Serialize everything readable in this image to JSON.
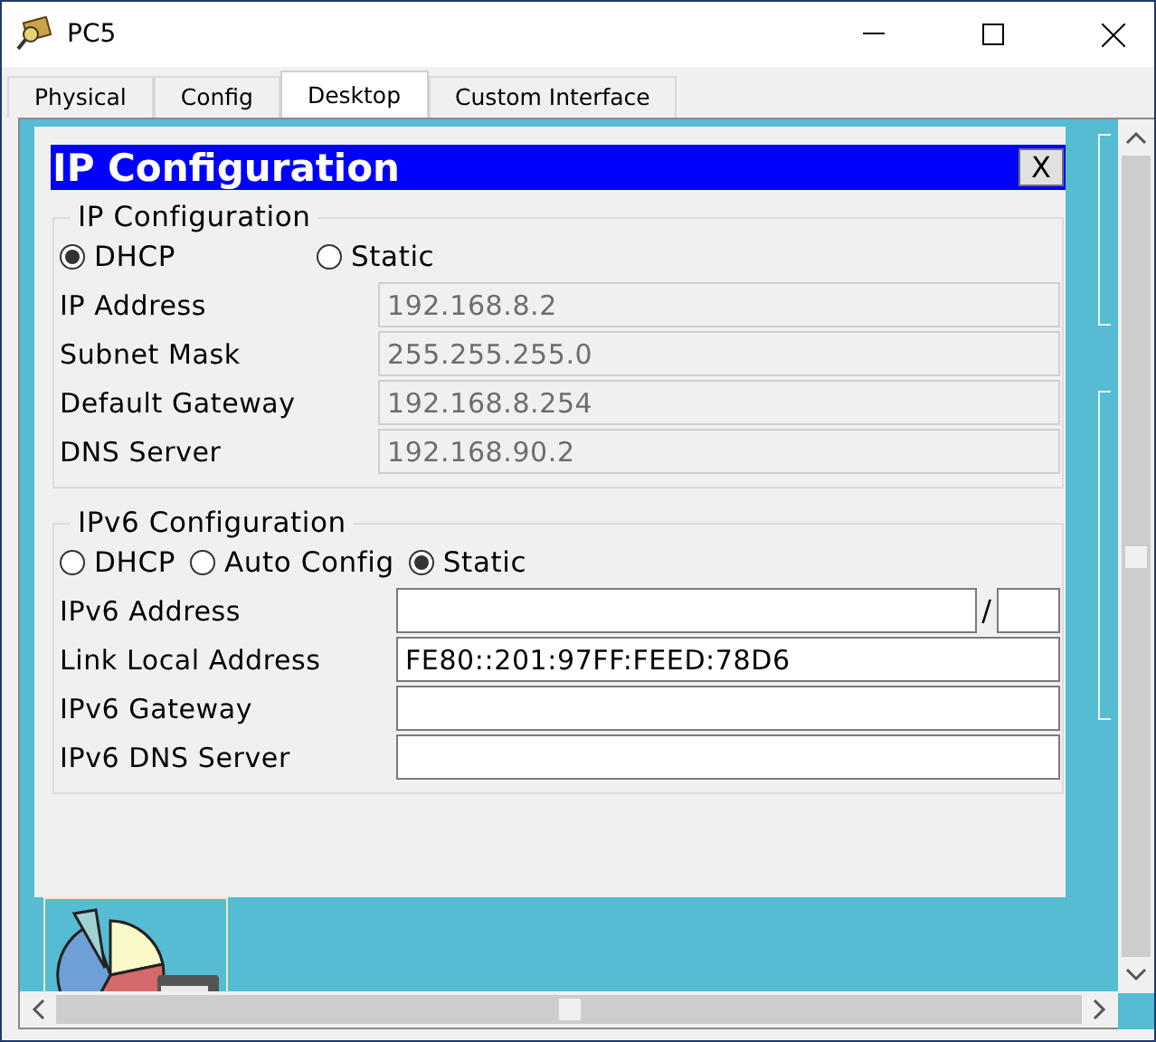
{
  "window": {
    "title": "PC5"
  },
  "tabs": [
    {
      "label": "Physical",
      "selected": false
    },
    {
      "label": "Config",
      "selected": false
    },
    {
      "label": "Desktop",
      "selected": true
    },
    {
      "label": "Custom Interface",
      "selected": false
    }
  ],
  "dialog": {
    "title": "IP Configuration",
    "close_label": "X",
    "ipv4": {
      "legend": "IP Configuration",
      "modes": [
        {
          "label": "DHCP",
          "selected": true
        },
        {
          "label": "Static",
          "selected": false
        }
      ],
      "fields": [
        {
          "label": "IP Address",
          "value": "192.168.8.2",
          "disabled": true
        },
        {
          "label": "Subnet Mask",
          "value": "255.255.255.0",
          "disabled": true
        },
        {
          "label": "Default Gateway",
          "value": "192.168.8.254",
          "disabled": true
        },
        {
          "label": "DNS Server",
          "value": "192.168.90.2",
          "disabled": true
        }
      ]
    },
    "ipv6": {
      "legend": "IPv6 Configuration",
      "modes": [
        {
          "label": "DHCP",
          "selected": false
        },
        {
          "label": "Auto Config",
          "selected": false
        },
        {
          "label": "Static",
          "selected": true
        }
      ],
      "fields": [
        {
          "kind": "prefixed",
          "label": "IPv6 Address",
          "separator": "/",
          "disabled": false
        },
        {
          "kind": "plain",
          "label": "Link Local Address",
          "value": "FE80::201:97FF:FEED:78D6",
          "disabled": false
        },
        {
          "kind": "plain",
          "label": "IPv6 Gateway",
          "disabled": false
        },
        {
          "kind": "plain",
          "label": "IPv6 DNS Server",
          "disabled": false
        }
      ]
    }
  }
}
